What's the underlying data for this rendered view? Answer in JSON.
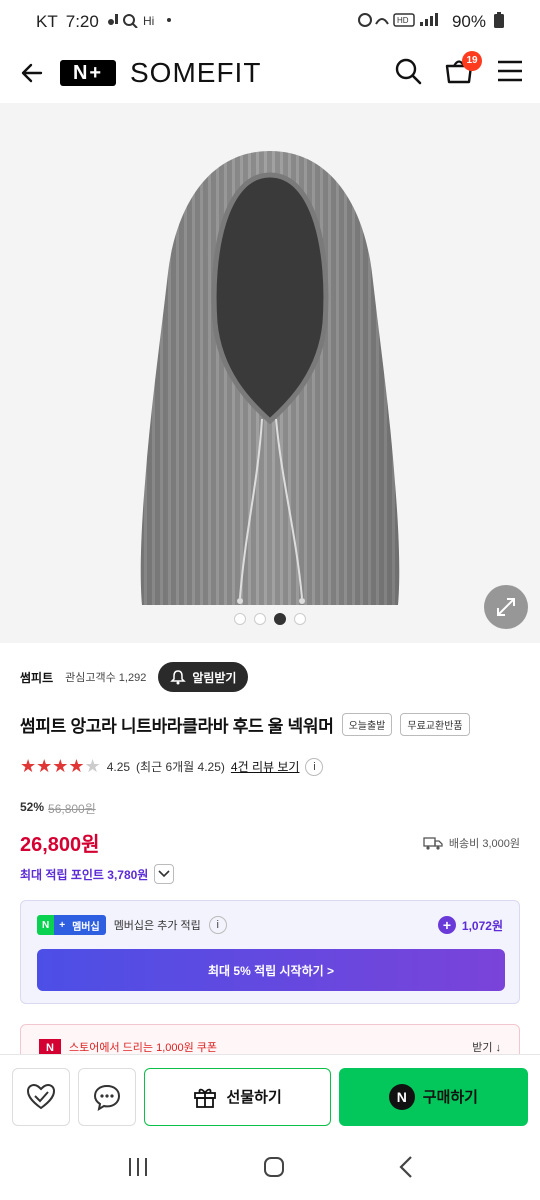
{
  "status": {
    "carrier": "KT",
    "time": "7:20",
    "battery": "90%"
  },
  "header": {
    "store_logo": "N+",
    "store_name": "SOMEFIT",
    "cart_count": "19",
    "icons": [
      "back-arrow-icon",
      "search-icon",
      "cart-icon",
      "menu-icon"
    ]
  },
  "gallery": {
    "dot_count": 4,
    "active_index": 2
  },
  "shop": {
    "brand": "썸피트",
    "fav_label": "관심고객수 1,292",
    "notify_label": "알림받기"
  },
  "product": {
    "title": "썸피트 앙고라 니트바라클라바 후드 울 넥워머",
    "tags": [
      "오늘출발",
      "무료교환반품"
    ],
    "rating": 4.25,
    "rating_text": "4.25",
    "rating_recent": "(최근 6개월 4.25)",
    "review_link": "4건 리뷰 보기",
    "discount_pct": "52%",
    "original_price": "56,800원",
    "price": "26,800원",
    "shipping": "배송비 3,000원",
    "max_points": "최대 적립 포인트 3,780원"
  },
  "membership": {
    "badge_n": "N",
    "badge_plus": "+",
    "badge_label": "멤버십",
    "text": "멤버십은 추가 적립",
    "points": "1,072원",
    "cta": "최대 5% 적립 시작하기 >"
  },
  "coupon": {
    "text": "스토어에서 드리는 1,000원 쿠폰",
    "action": "받기 ↓"
  },
  "bottom": {
    "gift_label": "선물하기",
    "buy_label": "구매하기"
  },
  "colors": {
    "price_red": "#d50032",
    "naver_green": "#03c75a",
    "purple": "#5b2bd6"
  }
}
